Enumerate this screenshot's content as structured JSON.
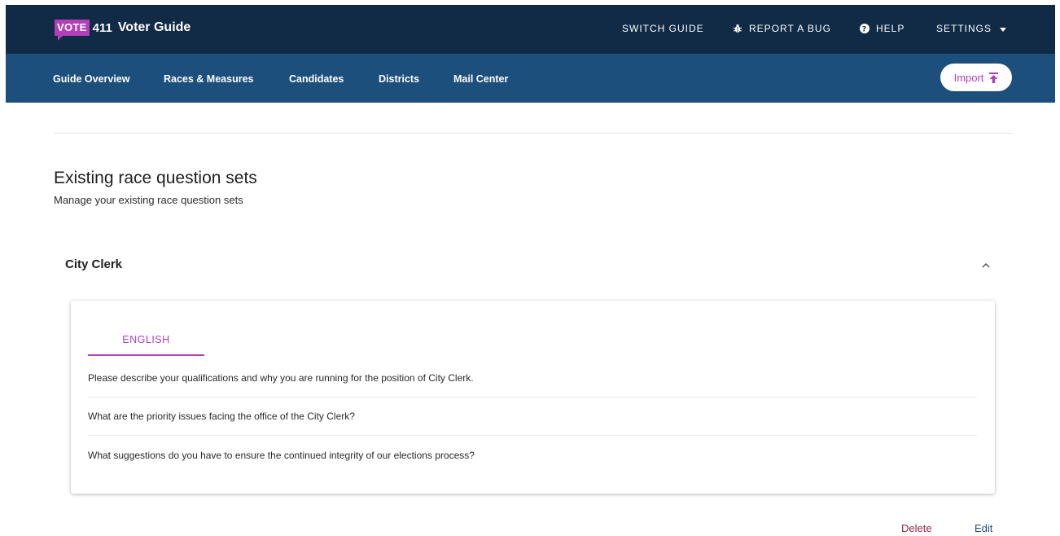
{
  "brand": {
    "badge": "VOTE",
    "number": "411",
    "title": "Voter Guide"
  },
  "topnav": {
    "switch_guide": "SWITCH GUIDE",
    "report_bug": "REPORT A BUG",
    "help": "HELP",
    "settings": "SETTINGS"
  },
  "subnav": {
    "items": [
      {
        "label": "Guide Overview"
      },
      {
        "label": "Races & Measures"
      },
      {
        "label": "Candidates"
      },
      {
        "label": "Districts"
      },
      {
        "label": "Mail Center"
      }
    ],
    "import_label": "Import"
  },
  "page": {
    "title": "Existing race question sets",
    "subtitle": "Manage your existing race question sets"
  },
  "race": {
    "title": "City Clerk",
    "tab_label": "ENGLISH",
    "questions": [
      "Please describe your qualifications and why you are running for the position of City Clerk.",
      "What are the priority issues facing the office of the City Clerk?",
      "What suggestions do you have to ensure the continued integrity of our elections process?"
    ],
    "delete_label": "Delete",
    "edit_label": "Edit"
  },
  "colors": {
    "topbar": "#112a46",
    "subnav": "#1d4f7c",
    "accent": "#b03fb9",
    "delete": "#9b2242"
  },
  "icons": {
    "report_bug": "bug-icon",
    "help": "help-circle-icon",
    "settings": "caret-down-icon",
    "import": "upload-icon",
    "race_toggle": "chevron-up-icon"
  }
}
